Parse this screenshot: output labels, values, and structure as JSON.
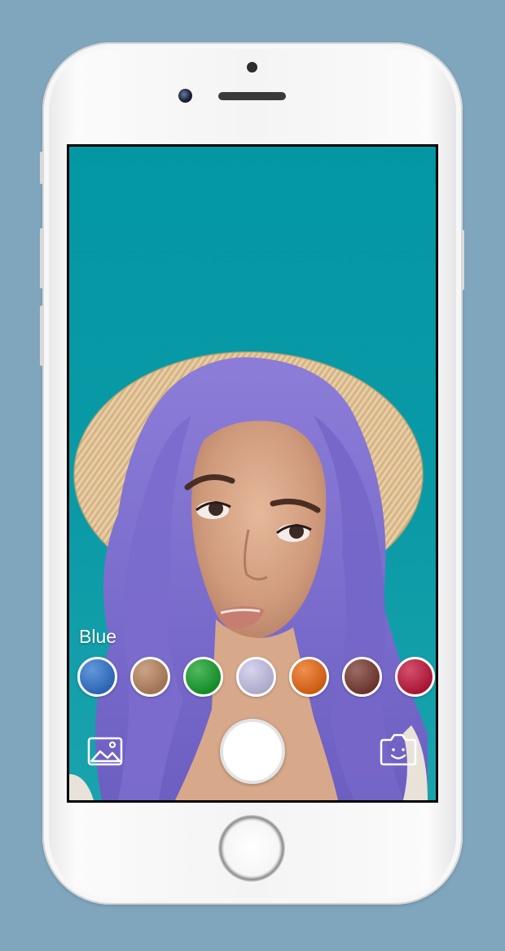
{
  "device": "iphone",
  "selected_color": {
    "label": "Blue"
  },
  "swatches": [
    {
      "name": "blue",
      "color": "#2f74d0"
    },
    {
      "name": "brown",
      "color": "#b9855e"
    },
    {
      "name": "green",
      "color": "#16a22c"
    },
    {
      "name": "lavender",
      "color": "#c9c5ea"
    },
    {
      "name": "orange",
      "color": "#ec6a12"
    },
    {
      "name": "auburn",
      "color": "#7a3a31"
    },
    {
      "name": "red",
      "color": "#c4163c"
    }
  ],
  "controls": {
    "gallery_icon": "image-gallery-icon",
    "shutter_icon": "shutter-button",
    "flip_icon": "camera-face-icon"
  },
  "colors": {
    "background": "#7fa6bd",
    "screen": "#0397a4",
    "hair": "#7b6bd2"
  }
}
